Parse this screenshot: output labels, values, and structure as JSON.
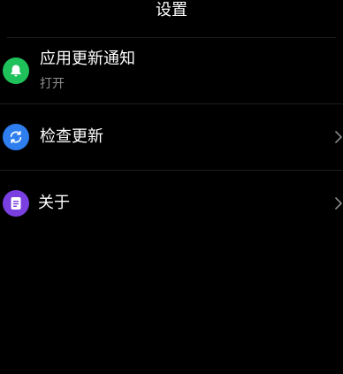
{
  "header": {
    "title": "设置"
  },
  "colors": {
    "background": "#000000",
    "notification_icon_bg": "#1fc15a",
    "update_icon_bg": "#2f7ef0",
    "about_icon_bg": "#7a3fe0",
    "divider": "#1e1e1e",
    "subtitle": "#8f8f8f"
  },
  "settings": {
    "notification": {
      "icon": "bell-icon",
      "title": "应用更新通知",
      "status": "打开"
    },
    "check_update": {
      "icon": "refresh-icon",
      "title": "检查更新"
    },
    "about": {
      "icon": "document-icon",
      "title": "关于"
    }
  }
}
